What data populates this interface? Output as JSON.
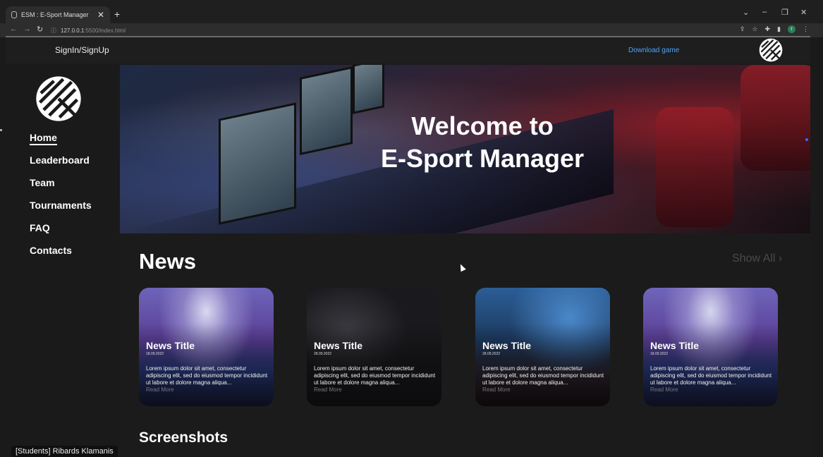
{
  "browser": {
    "tab_title": "ESM : E-Sport Manager",
    "tab_close": "✕",
    "new_tab": "+",
    "url_host": "127.0.0.1",
    "url_path": ":5500/index.html",
    "window_controls": [
      "⌄",
      "–",
      "❐",
      "✕"
    ]
  },
  "header": {
    "signin": "SignIn/SignUp",
    "download": "Download game"
  },
  "sidebar": {
    "items": [
      {
        "label": "Home"
      },
      {
        "label": "Leaderboard"
      },
      {
        "label": "Team"
      },
      {
        "label": "Tournaments"
      },
      {
        "label": "FAQ"
      },
      {
        "label": "Contacts"
      }
    ]
  },
  "hero": {
    "line1": "Welcome to",
    "line2": "E-Sport Manager"
  },
  "news": {
    "heading": "News",
    "show_all": "Show All",
    "cards": [
      {
        "title": "News Title",
        "date": "18.09.2022",
        "text": "Lorem ipsum dolor sit amet, consectetur adipiscing elit, sed do eiusmod tempor incididunt ut labore et dolore magna aliqua...",
        "read_more": "Read More"
      },
      {
        "title": "News Title",
        "date": "28.09.2022",
        "text": "Lorem ipsum dolor sit amet, consectetur adipiscing elit, sed do eiusmod tempor incididunt ut labore et dolore magna aliqua...",
        "read_more": "Read More"
      },
      {
        "title": "News Title",
        "date": "28.09.2022",
        "text": "Lorem ipsum dolor sit amet, consectetur adipiscing elit, sed do eiusmod tempor incididunt ut labore et dolore magna aliqua...",
        "read_more": "Read More"
      },
      {
        "title": "News Title",
        "date": "18.09.2022",
        "text": "Lorem ipsum dolor sit amet, consectetur adipiscing elit, sed do eiusmod tempor incididunt ut labore et dolore magna aliqua...",
        "read_more": "Read More"
      }
    ]
  },
  "screenshots": {
    "heading": "Screenshots"
  },
  "tooltip": "[Students] Ribards Klamanis",
  "colors": {
    "accent_link": "#4aa3ff",
    "background": "#1b1b1b"
  }
}
